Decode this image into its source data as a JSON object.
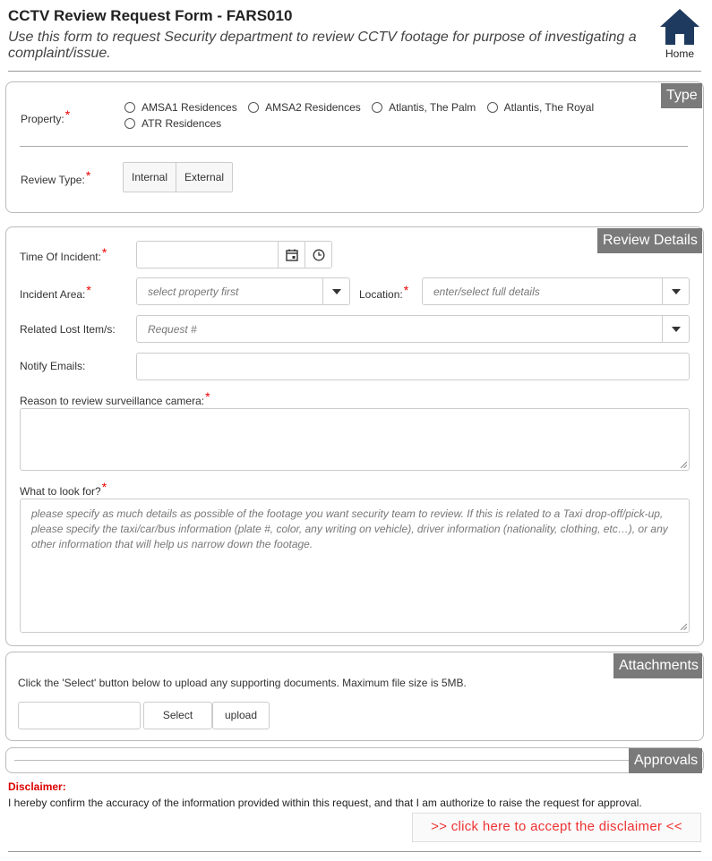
{
  "header": {
    "title": "CCTV Review Request Form - FARS010",
    "subtitle": "Use this form to request Security department to review CCTV footage for purpose of investigating a complaint/issue.",
    "home_label": "Home",
    "home_icon": "home-icon"
  },
  "type_panel": {
    "tag": "Type",
    "property_label": "Property:",
    "properties": [
      "AMSA1 Residences",
      "AMSA2 Residences",
      "Atlantis, The Palm",
      "Atlantis, The Royal",
      "ATR Residences"
    ],
    "review_type_label": "Review Type:",
    "review_types": [
      "Internal",
      "External"
    ],
    "required_mark": "*"
  },
  "details_panel": {
    "tag": "Review Details",
    "time_label": "Time Of Incident:",
    "calendar_icon": "calendar-icon",
    "clock_icon": "clock-icon",
    "area_label": "Incident Area:",
    "area_placeholder": "select property first",
    "location_label": "Location:",
    "location_placeholder": "enter/select full details",
    "lost_label": "Related Lost Item/s:",
    "lost_placeholder": "Request #",
    "notify_label": "Notify Emails:",
    "reason_label": "Reason to review surveillance camera:",
    "look_label": "What to look for?",
    "look_placeholder": "please specify as much details as possible of the footage you want security team to review. If this is related to a Taxi drop-off/pick-up, please specify the taxi/car/bus information (plate #, color, any writing on vehicle), driver information (nationality, clothing, etc…), or any other information that will help us narrow down the footage."
  },
  "attachments_panel": {
    "tag": "Attachments",
    "instruction": "Click the 'Select' button below to upload any supporting documents. Maximum file size is 5MB.",
    "select_label": "Select",
    "upload_label": "upload"
  },
  "approvals_panel": {
    "tag": "Approvals"
  },
  "disclaimer": {
    "title": "Disclaimer:",
    "text": "I hereby confirm the accuracy of the information provided within this request, and that I am authorize to raise the request for approval.",
    "accept_label": ">> click here to accept the disclaimer <<"
  },
  "colors": {
    "accent_tag": "#7a7a7a",
    "required": "#e00000",
    "home_icon": "#1f3a5f",
    "disclaimer": "#dd0000"
  }
}
